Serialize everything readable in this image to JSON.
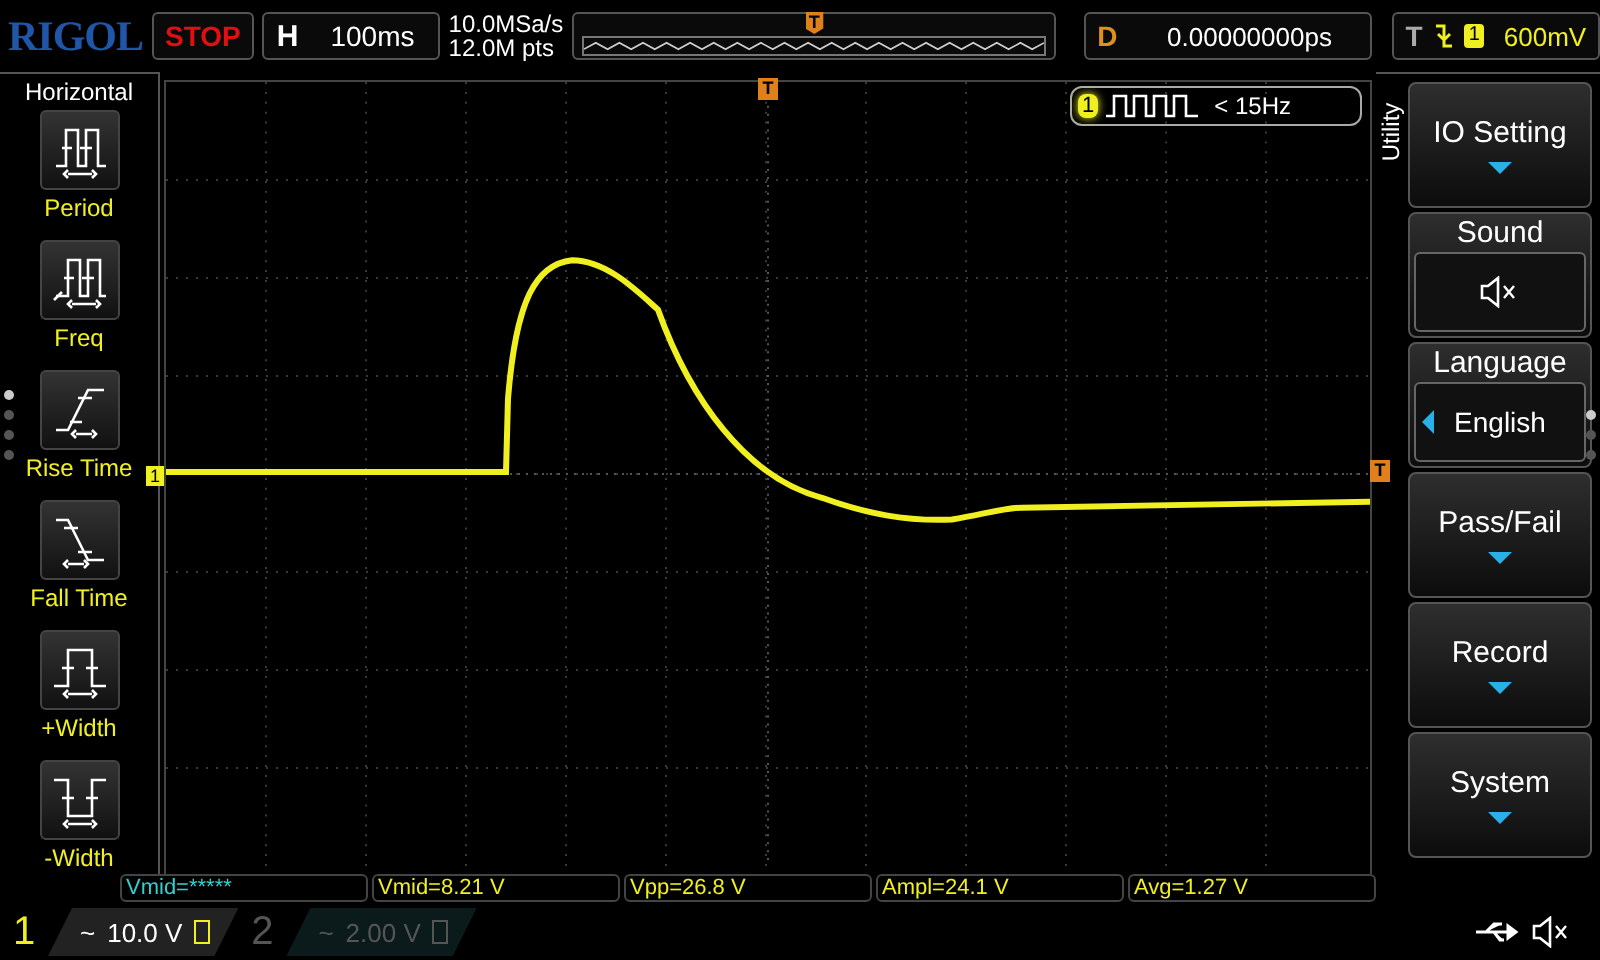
{
  "header": {
    "logo": "RIGOL",
    "run_state": "STOP",
    "timebase": {
      "label": "H",
      "value": "100ms"
    },
    "sample_rate": "10.0MSa/s",
    "memory_depth": "12.0M pts",
    "trigger_position": "T",
    "delay": {
      "label": "D",
      "value": "0.00000000ps"
    },
    "trigger": {
      "label": "T",
      "channel": "1",
      "level": "600mV"
    }
  },
  "left_menu": {
    "title": "Horizontal",
    "items": [
      {
        "kind": "period",
        "label": "Period"
      },
      {
        "kind": "freq",
        "label": "Freq"
      },
      {
        "kind": "rise",
        "label": "Rise Time"
      },
      {
        "kind": "fall",
        "label": "Fall Time"
      },
      {
        "kind": "pwidth",
        "label": "+Width"
      },
      {
        "kind": "nwidth",
        "label": "-Width"
      }
    ],
    "pages": [
      {
        "selected": true
      },
      {
        "selected": false
      },
      {
        "selected": false
      },
      {
        "selected": false
      }
    ]
  },
  "display": {
    "trigger_top_marker": "T",
    "channel_marker": "1",
    "trigger_level_marker": "T",
    "frequency_badge": {
      "channel": "1",
      "text": "< 15Hz"
    }
  },
  "right_menu": {
    "title": "Utility",
    "items": [
      {
        "kind": "submenu",
        "label": "IO Setting"
      },
      {
        "kind": "toggle",
        "label": "Sound",
        "muted": true
      },
      {
        "kind": "select",
        "label": "Language",
        "value": "English"
      },
      {
        "kind": "submenu",
        "label": "Pass/Fail"
      },
      {
        "kind": "submenu",
        "label": "Record"
      },
      {
        "kind": "submenu",
        "label": "System"
      }
    ],
    "pages": [
      {
        "selected": true
      },
      {
        "selected": false
      },
      {
        "selected": false
      }
    ]
  },
  "measurements": [
    {
      "text": "Vmid=*****",
      "selected": true
    },
    {
      "text": "Vmid=8.21 V",
      "selected": false
    },
    {
      "text": "Vpp=26.8 V",
      "selected": false
    },
    {
      "text": "Ampl=24.1 V",
      "selected": false
    },
    {
      "text": "Avg=1.27 V",
      "selected": false
    }
  ],
  "channels": [
    {
      "label": "1",
      "coupling": "~",
      "scale": "10.0 V",
      "on": true
    },
    {
      "label": "2",
      "coupling": "~",
      "scale": "2.00 V",
      "on": false
    }
  ]
}
